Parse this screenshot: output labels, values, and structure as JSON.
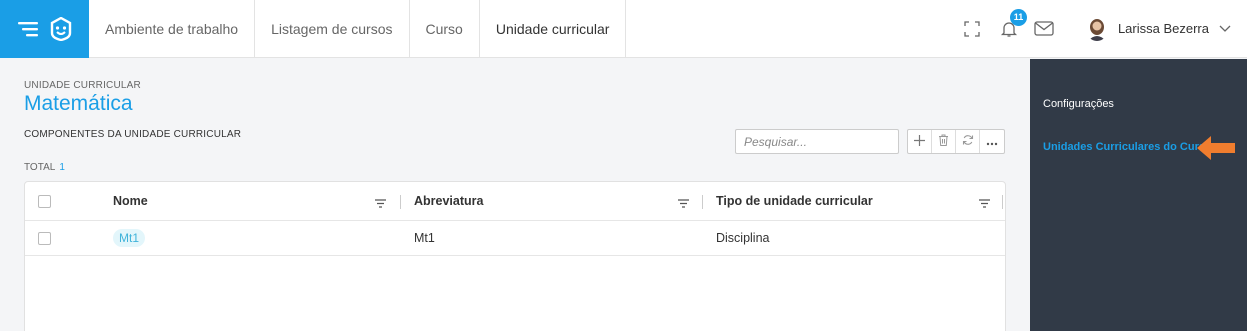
{
  "header": {
    "tabs": [
      {
        "label": "Ambiente de trabalho"
      },
      {
        "label": "Listagem de cursos"
      },
      {
        "label": "Curso"
      },
      {
        "label": "Unidade curricular"
      }
    ],
    "notifications_count": "11",
    "user_name": "Larissa Bezerra"
  },
  "page": {
    "overline": "UNIDADE CURRICULAR",
    "title": "Matemática",
    "section_title": "COMPONENTES DA UNIDADE CURRICULAR",
    "total_label": "TOTAL",
    "total_value": "1"
  },
  "search": {
    "placeholder": "Pesquisar..."
  },
  "table": {
    "columns": [
      "Nome",
      "Abreviatura",
      "Tipo de unidade curricular"
    ],
    "rows": [
      {
        "nome": "Mt1",
        "abreviatura": "Mt1",
        "tipo": "Disciplina"
      }
    ]
  },
  "sidebar": {
    "items": [
      {
        "label": "Configurações"
      },
      {
        "label": "Unidades Curriculares do Curso"
      }
    ]
  },
  "colors": {
    "accent": "#1a9ee6",
    "sidebar_bg": "#313a47",
    "arrow": "#f07d2e"
  }
}
